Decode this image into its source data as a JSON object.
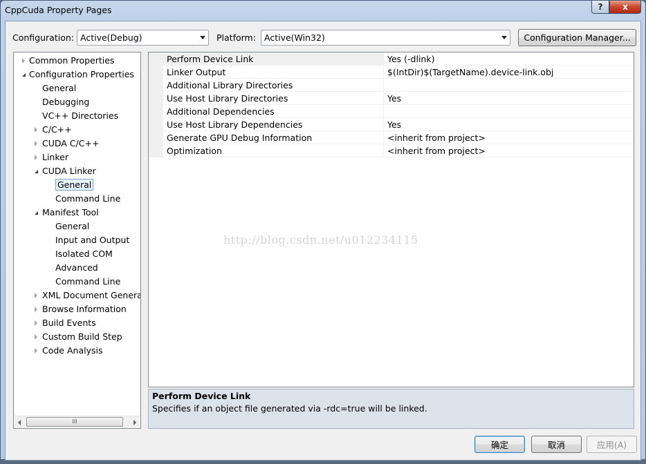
{
  "window": {
    "title": "CppCuda Property Pages",
    "help_glyph": "?",
    "close_glyph": "x"
  },
  "config": {
    "configuration_label": "Configuration:",
    "configuration_value": "Active(Debug)",
    "platform_label": "Platform:",
    "platform_value": "Active(Win32)",
    "manager_button": "Configuration Manager..."
  },
  "tree": {
    "items": [
      {
        "label": "Common Properties"
      },
      {
        "label": "Configuration Properties"
      },
      {
        "label": "General"
      },
      {
        "label": "Debugging"
      },
      {
        "label": "VC++ Directories"
      },
      {
        "label": "C/C++"
      },
      {
        "label": "CUDA C/C++"
      },
      {
        "label": "Linker"
      },
      {
        "label": "CUDA Linker"
      },
      {
        "label": "General"
      },
      {
        "label": "Command Line"
      },
      {
        "label": "Manifest Tool"
      },
      {
        "label": "General"
      },
      {
        "label": "Input and Output"
      },
      {
        "label": "Isolated COM"
      },
      {
        "label": "Advanced"
      },
      {
        "label": "Command Line"
      },
      {
        "label": "XML Document Generat"
      },
      {
        "label": "Browse Information"
      },
      {
        "label": "Build Events"
      },
      {
        "label": "Custom Build Step"
      },
      {
        "label": "Code Analysis"
      }
    ],
    "scroll_thumb_grip": "III"
  },
  "grid": {
    "rows": [
      {
        "name": "Perform Device Link",
        "value": "Yes (-dlink)"
      },
      {
        "name": "Linker Output",
        "value": "$(IntDir)$(TargetName).device-link.obj"
      },
      {
        "name": "Additional Library Directories",
        "value": ""
      },
      {
        "name": "Use Host Library Directories",
        "value": "Yes"
      },
      {
        "name": "Additional Dependencies",
        "value": ""
      },
      {
        "name": "Use Host Library Dependencies",
        "value": "Yes"
      },
      {
        "name": "Generate GPU Debug Information",
        "value": "<inherit from project>"
      },
      {
        "name": "Optimization",
        "value": "<inherit from project>"
      }
    ],
    "watermark": "http://blog.csdn.net/u012234115"
  },
  "description": {
    "title": "Perform Device Link",
    "text": "Specifies if an object file generated via -rdc=true will be linked."
  },
  "buttons": {
    "ok": "确定",
    "cancel": "取消",
    "apply": "应用(A)"
  }
}
